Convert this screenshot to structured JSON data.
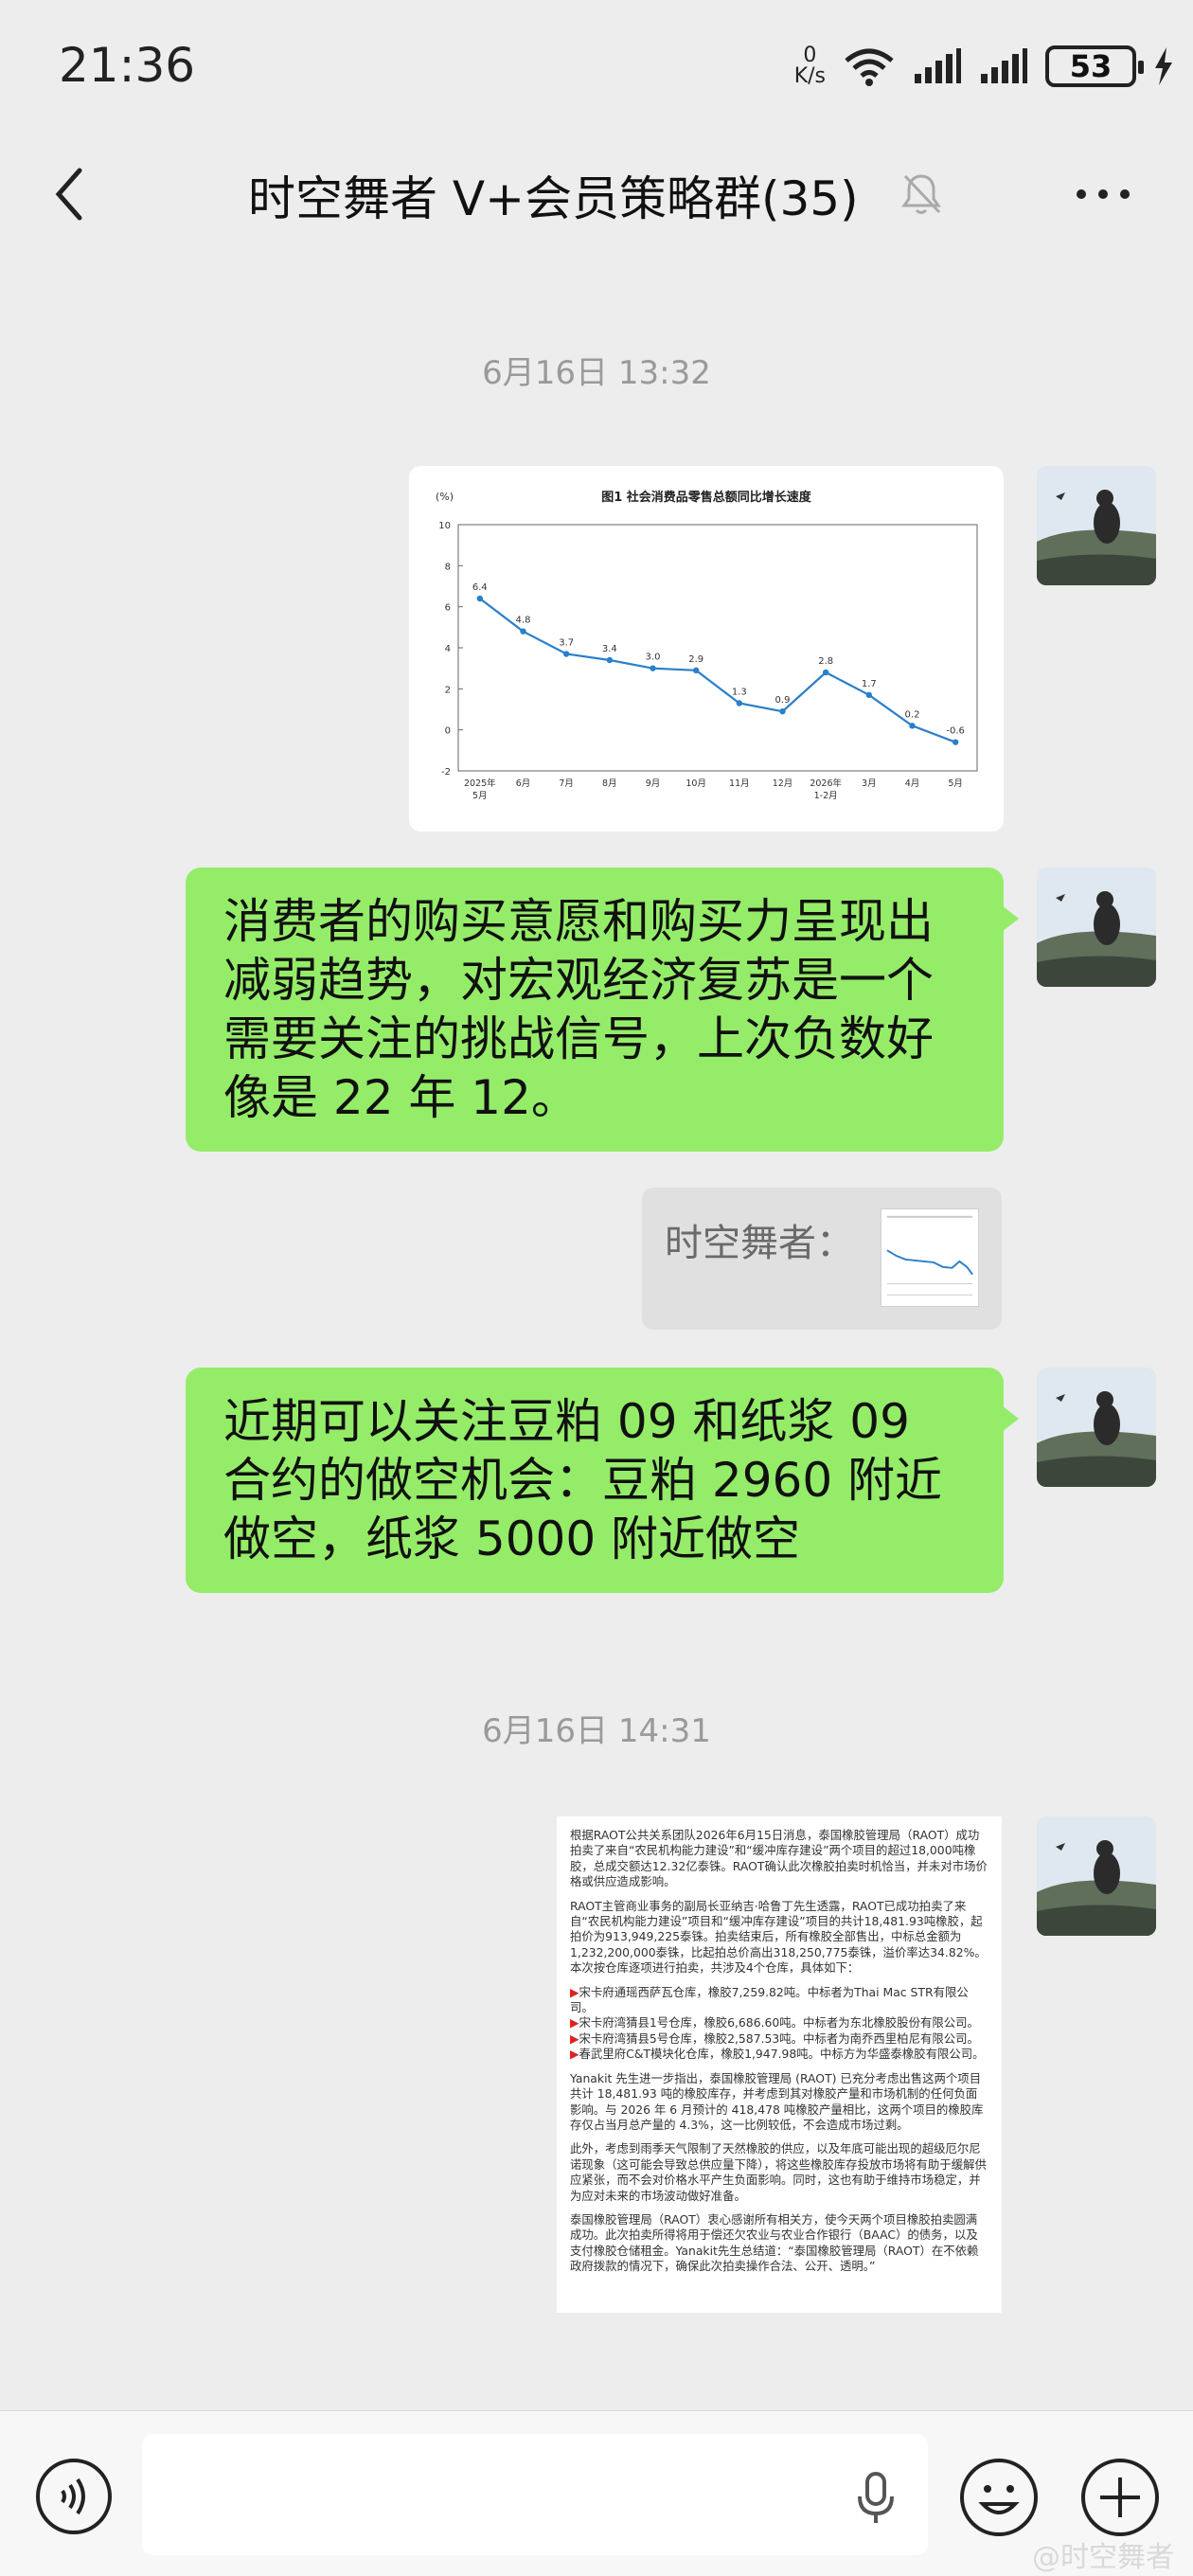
{
  "status_bar": {
    "time": "21:36",
    "net_speed_value": "0",
    "net_speed_unit": "K/s",
    "battery": "53"
  },
  "header": {
    "title": "时空舞者 V+会员策略群(35)"
  },
  "messages": {
    "ts1": "6月16日 13:32",
    "ts2": "6月16日 14:31",
    "text1": "消费者的购买意愿和购买力呈现出减弱趋势，对宏观经济复苏是一个需要关注的挑战信号，上次负数好像是 22 年 12。",
    "quote_author": "时空舞者：",
    "text2": "近期可以关注豆粕 09 和纸浆 09 合约的做空机会：豆粕 2960 附近做空，纸浆 5000 附近做空"
  },
  "chart_data": {
    "type": "line",
    "title": "图1  社会消费品零售总额同比增长速度",
    "ylabel": "(%)",
    "ylim": [
      -2,
      10
    ],
    "yticks": [
      "-2",
      "0",
      "2",
      "4",
      "6",
      "8",
      "10"
    ],
    "categories": [
      "2025年\n5月",
      "6月",
      "7月",
      "8月",
      "9月",
      "10月",
      "11月",
      "12月",
      "2026年\n1-2月",
      "3月",
      "4月",
      "5月"
    ],
    "values": [
      6.4,
      4.8,
      3.7,
      3.4,
      3.0,
      2.9,
      1.3,
      0.9,
      2.8,
      1.7,
      0.2,
      -0.6
    ],
    "data_labels": [
      "6.4",
      "4.8",
      "3.7",
      "3.4",
      "3.0",
      "2.9",
      "1.3",
      "0.9",
      "2.8",
      "1.7",
      "0.2",
      "-0.6"
    ],
    "line_color": "#2a7fc9"
  },
  "document": {
    "p1": "根据RAOT公共关系团队2026年6月15日消息，泰国橡胶管理局（RAOT）成功拍卖了来自“农民机构能力建设”和“缓冲库存建设”两个项目的超过18,000吨橡胶，总成交额达12.32亿泰铢。RAOT确认此次橡胶拍卖时机恰当，并未对市场价格或供应造成影响。",
    "p2": "RAOT主管商业事务的副局长亚纳吉·哈鲁丁先生透露，RAOT已成功拍卖了来自“农民机构能力建设”项目和“缓冲库存建设”项目的共计18,481.93吨橡胶，起拍价为913,949,225泰铢。拍卖结束后，所有橡胶全部售出，中标总金额为1,232,200,000泰铢，比起拍总价高出318,250,775泰铢，溢价率达34.82%。本次按仓库逐项进行拍卖，共涉及4个仓库，具体如下：",
    "list": [
      "宋卡府通瑶西萨瓦仓库，橡胶7,259.82吨。中标者为Thai Mac STR有限公司。",
      "宋卡府湾猜县1号仓库，橡胶6,686.60吨。中标者为东北橡胶股份有限公司。",
      "宋卡府湾猜县5号仓库，橡胶2,587.53吨。中标者为南乔西里柏尼有限公司。",
      "春武里府C&T模块化仓库，橡胶1,947.98吨。中标方为华盛泰橡胶有限公司。"
    ],
    "p3": "Yanakit 先生进一步指出，泰国橡胶管理局 (RAOT) 已充分考虑出售这两个项目共计 18,481.93 吨的橡胶库存，并考虑到其对橡胶产量和市场机制的任何负面影响。与 2026 年 6 月预计的 418,478 吨橡胶产量相比，这两个项目的橡胶库存仅占当月总产量的 4.3%，这一比例较低，不会造成市场过剩。",
    "p4": "此外，考虑到雨季天气限制了天然橡胶的供应，以及年底可能出现的超级厄尔尼诺现象（这可能会导致总供应量下降），将这些橡胶库存投放市场将有助于缓解供应紧张，而不会对价格水平产生负面影响。同时，这也有助于维持市场稳定，并为应对未来的市场波动做好准备。",
    "p5": "泰国橡胶管理局（RAOT）衷心感谢所有相关方，使今天两个项目橡胶拍卖圆满成功。此次拍卖所得将用于偿还欠农业与农业合作银行（BAAC）的债务，以及支付橡胶仓储租金。Yanakit先生总结道：“泰国橡胶管理局（RAOT）在不依赖政府拨款的情况下，确保此次拍卖操作合法、公开、透明。”"
  },
  "watermark": "@时空舞者"
}
